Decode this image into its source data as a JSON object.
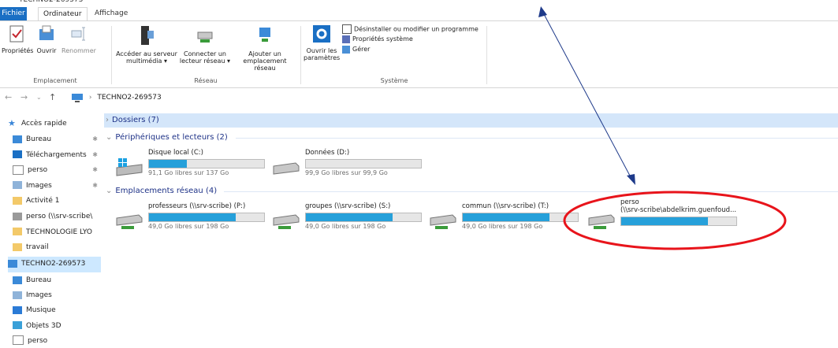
{
  "ribbon": {
    "tabs": [
      "Fichier",
      "Ordinateur",
      "Affichage"
    ],
    "emplacement": {
      "label": "Emplacement",
      "buttons": [
        "Propriétés",
        "Ouvrir",
        "Renommer"
      ]
    },
    "reseau": {
      "label": "Réseau",
      "buttons": [
        [
          "Accéder au serveur",
          "multimédia ▾"
        ],
        [
          "Connecter un",
          "lecteur réseau ▾"
        ],
        [
          "Ajouter un",
          "emplacement réseau"
        ]
      ]
    },
    "systeme": {
      "label": "Système",
      "open_settings": [
        "Ouvrir les",
        "paramètres"
      ],
      "small_items": [
        "Désinstaller ou modifier un programme",
        "Propriétés système",
        "Gérer"
      ]
    }
  },
  "address": {
    "path": "TECHNO2-269573",
    "breadcrumb_arrow": "›"
  },
  "sidebar": {
    "quick_access": "Accès rapide",
    "quick_items": [
      {
        "label": "Bureau",
        "icon": "desktop-icon",
        "pinned": true
      },
      {
        "label": "Téléchargements",
        "icon": "download-icon",
        "pinned": true
      },
      {
        "label": "perso",
        "icon": "document-icon",
        "pinned": true
      },
      {
        "label": "Images",
        "icon": "images-icon",
        "pinned": true
      },
      {
        "label": "Activité 1",
        "icon": "folder-icon",
        "pinned": false
      },
      {
        "label": "perso (\\\\srv-scribe\\",
        "icon": "network-drive-icon",
        "pinned": false
      },
      {
        "label": "TECHNOLOGIE LYO",
        "icon": "folder-icon",
        "pinned": false
      },
      {
        "label": "travail",
        "icon": "folder-icon",
        "pinned": false
      }
    ],
    "this_pc": "TECHNO2-269573",
    "pc_items": [
      {
        "label": "Bureau",
        "icon": "desktop-icon"
      },
      {
        "label": "Images",
        "icon": "images-icon"
      },
      {
        "label": "Musique",
        "icon": "music-icon"
      },
      {
        "label": "Objets 3D",
        "icon": "cube-icon"
      },
      {
        "label": "perso",
        "icon": "document-icon"
      }
    ]
  },
  "content": {
    "groups": {
      "folders": "Dossiers (7)",
      "devices": "Périphériques et lecteurs (2)",
      "network": "Emplacements réseau (4)"
    },
    "drives": [
      {
        "name": "Disque local (C:)",
        "free": "91,1 Go libres sur 137 Go",
        "used_fraction": 0.33,
        "icon": "windows-drive-icon"
      },
      {
        "name": "Données (D:)",
        "free": "99,9 Go libres sur 99,9 Go",
        "used_fraction": 0.0,
        "icon": "hard-drive-icon"
      }
    ],
    "network_locations": [
      {
        "name": "professeurs (\\\\srv-scribe) (P:)",
        "free": "49,0 Go libres sur 198 Go",
        "used_fraction": 0.75
      },
      {
        "name": "groupes (\\\\srv-scribe) (S:)",
        "free": "49,0 Go libres sur 198 Go",
        "used_fraction": 0.75
      },
      {
        "name": "commun (\\\\srv-scribe) (T:)",
        "free": "49,0 Go libres sur 198 Go",
        "used_fraction": 0.75
      },
      {
        "name": "perso",
        "subname": "(\\\\srv-scribe\\abdelkrim.guenfoud...",
        "used_fraction": 0.75
      }
    ]
  },
  "colors": {
    "accent": "#1a6fc4",
    "usage_bar": "#26a0da",
    "annotation": "#e8141b",
    "selection": "#cde8ff"
  }
}
